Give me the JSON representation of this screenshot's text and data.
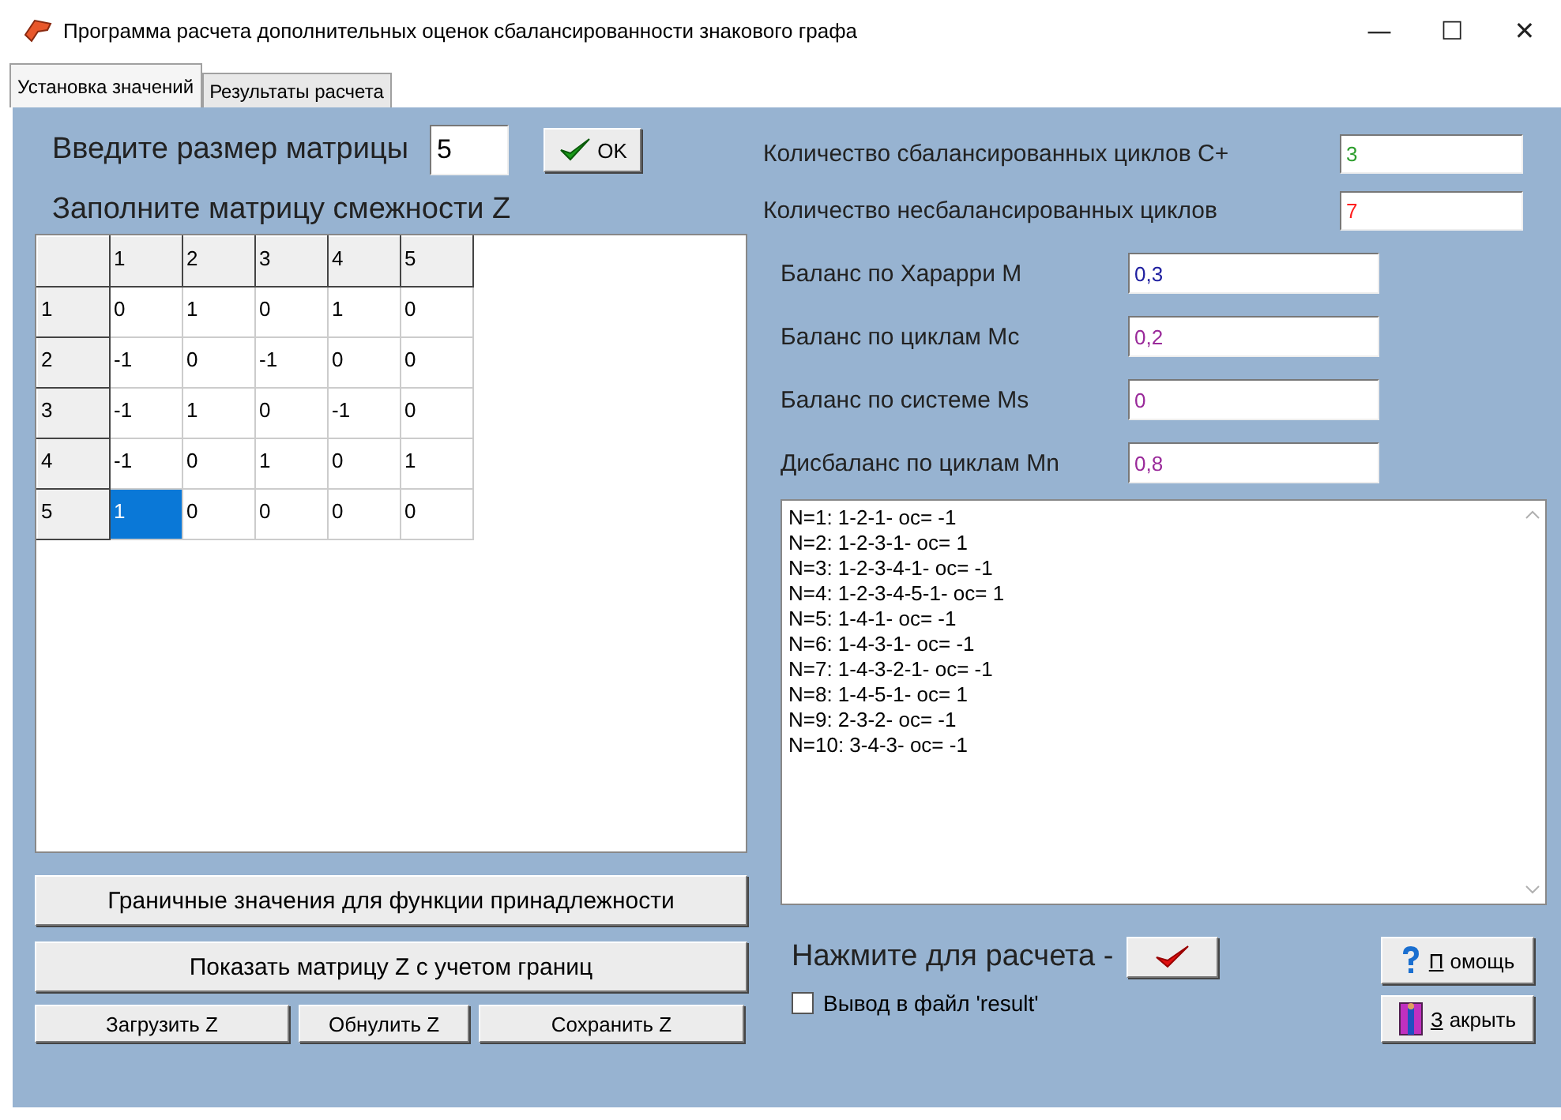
{
  "window": {
    "title": "Программа расчета дополнительных оценок сбалансированности знакового графа",
    "controls": [
      "—",
      "☐",
      "✕"
    ]
  },
  "tabs": [
    {
      "label": "Установка значений",
      "selected": true
    },
    {
      "label": "Результаты расчета",
      "selected": false
    }
  ],
  "size": {
    "label": "Введите размер матрицы",
    "value": "5",
    "ok_button": "OK"
  },
  "matrix": {
    "label": "Заполните матрицу смежности Z",
    "columns": [
      "1",
      "2",
      "3",
      "4",
      "5"
    ],
    "rows": [
      {
        "header": "1",
        "cells": [
          {
            "value": "0",
            "selected": false
          },
          {
            "value": "1",
            "selected": false
          },
          {
            "value": "0",
            "selected": false
          },
          {
            "value": "1",
            "selected": false
          },
          {
            "value": "0",
            "selected": false
          }
        ]
      },
      {
        "header": "2",
        "cells": [
          {
            "value": "-1",
            "selected": false
          },
          {
            "value": "0",
            "selected": false
          },
          {
            "value": "-1",
            "selected": false
          },
          {
            "value": "0",
            "selected": false
          },
          {
            "value": "0",
            "selected": false
          }
        ]
      },
      {
        "header": "3",
        "cells": [
          {
            "value": "-1",
            "selected": false
          },
          {
            "value": "1",
            "selected": false
          },
          {
            "value": "0",
            "selected": false
          },
          {
            "value": "-1",
            "selected": false
          },
          {
            "value": "0",
            "selected": false
          }
        ]
      },
      {
        "header": "4",
        "cells": [
          {
            "value": "-1",
            "selected": false
          },
          {
            "value": "0",
            "selected": false
          },
          {
            "value": "1",
            "selected": false
          },
          {
            "value": "0",
            "selected": false
          },
          {
            "value": "1",
            "selected": false
          }
        ]
      },
      {
        "header": "5",
        "cells": [
          {
            "value": "1",
            "selected": true
          },
          {
            "value": "0",
            "selected": false
          },
          {
            "value": "0",
            "selected": false
          },
          {
            "value": "0",
            "selected": false
          },
          {
            "value": "0",
            "selected": false
          }
        ]
      }
    ]
  },
  "left_buttons": {
    "bounds": "Граничные значения для функции принадлежности",
    "show": "Показать матрицу Z с учетом границ",
    "load": "Загрузить Z",
    "reset": "Обнулить Z",
    "save": "Сохранить Z"
  },
  "counts": [
    {
      "label": "Количество сбалансированных циклов С+",
      "value": "3",
      "color": "#2e9e2e"
    },
    {
      "label": "Количество несбалансированных циклов",
      "value": "7",
      "color": "#ff2020"
    }
  ],
  "balances": [
    {
      "label": "Баланс по Харарри М",
      "value": "0,3",
      "color": "#2020a0"
    },
    {
      "label": "Баланс по циклам Мс",
      "value": "0,2",
      "color": "#9a2a9a"
    },
    {
      "label": "Баланс по системе Ms",
      "value": "0",
      "color": "#9a2a9a"
    },
    {
      "label": "Дисбаланс по циклам Мn",
      "value": "0,8",
      "color": "#9a2a9a"
    }
  ],
  "cycles": [
    "N=1: 1-2-1- oc= -1",
    "N=2: 1-2-3-1- oc= 1",
    "N=3: 1-2-3-4-1- oc= -1",
    "N=4: 1-2-3-4-5-1- oc= 1",
    "N=5: 1-4-1- oc= -1",
    "N=6: 1-4-3-1- oc= -1",
    "N=7: 1-4-3-2-1- oc= -1",
    "N=8: 1-4-5-1- oc= 1",
    "N=9: 2-3-2- oc= -1",
    "N=10: 3-4-3- oc= -1"
  ],
  "calculate_label": "Нажмите для расчета -",
  "output_to_file": {
    "label": "Вывод в файл 'result'",
    "checked": false
  },
  "help_button": {
    "accel": "П",
    "rest": "омощь"
  },
  "close_button": {
    "accel": "З",
    "rest": "акрыть"
  }
}
